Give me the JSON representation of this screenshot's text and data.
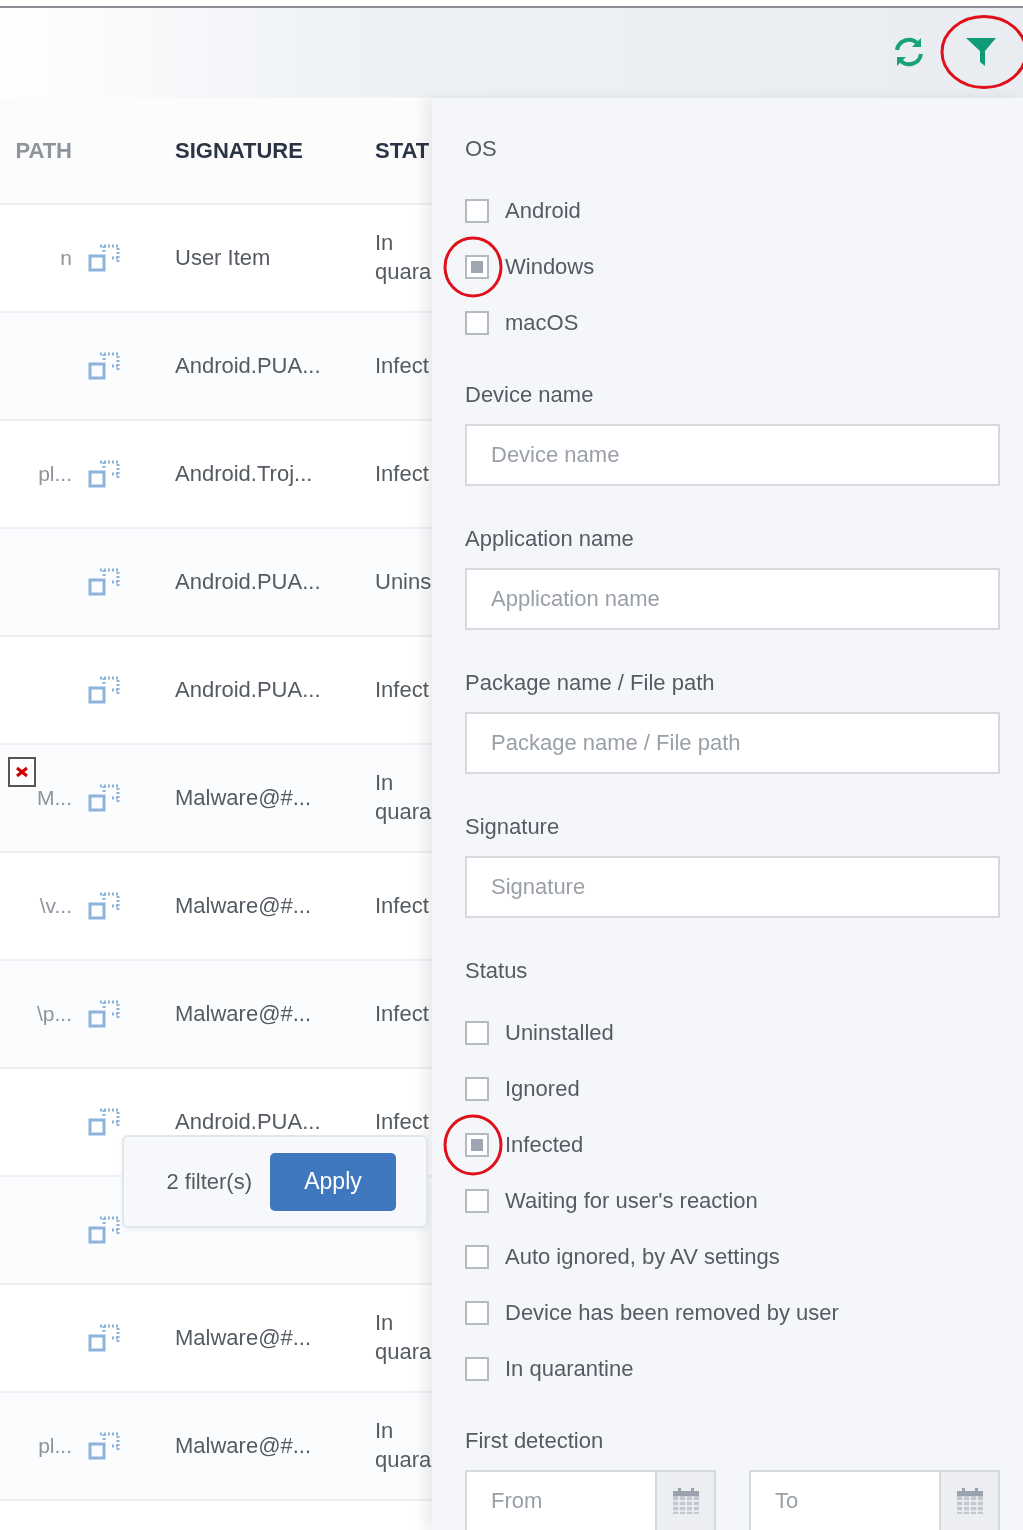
{
  "toolbar": {
    "filter_button": {
      "highlighted": true
    }
  },
  "table": {
    "columns": [
      "PATH",
      "SIGNATURE",
      "STAT"
    ],
    "rows": [
      {
        "path": "n",
        "signature": "User Item",
        "status": "In quara"
      },
      {
        "signature": "Android.PUA...",
        "status": "Infect"
      },
      {
        "path": "pl...",
        "signature": "Android.Troj...",
        "status": "Infect"
      },
      {
        "signature": "Android.PUA...",
        "status": "Unins"
      },
      {
        "signature": "Android.PUA...",
        "status": "Infect"
      },
      {
        "path": "M...",
        "signature": "Malware@#...",
        "status": "In quara"
      },
      {
        "path": "\\v...",
        "signature": "Malware@#...",
        "status": "Infect"
      },
      {
        "path": "\\p...",
        "signature": "Malware@#...",
        "status": "Infect"
      },
      {
        "signature": "Android.PUA...",
        "status": "Infect"
      },
      {},
      {
        "signature": "Malware@#...",
        "status": "In quara"
      },
      {
        "path": "pl...",
        "signature": "Malware@#...",
        "status": "In quara"
      }
    ]
  },
  "apply_popup": {
    "count": "2 filter(s)",
    "button": "Apply"
  },
  "filter_panel": {
    "os": {
      "label": "OS",
      "options": [
        {
          "label": "Android",
          "checked": false,
          "highlighted": false
        },
        {
          "label": "Windows",
          "checked": true,
          "highlighted": true
        },
        {
          "label": "macOS",
          "checked": false,
          "highlighted": false
        }
      ]
    },
    "fields": [
      {
        "label": "Device name",
        "placeholder": "Device name"
      },
      {
        "label": "Application name",
        "placeholder": "Application name"
      },
      {
        "label": "Package name / File path",
        "placeholder": "Package name / File path"
      },
      {
        "label": "Signature",
        "placeholder": "Signature"
      }
    ],
    "status": {
      "label": "Status",
      "options": [
        {
          "label": "Uninstalled",
          "checked": false,
          "highlighted": false
        },
        {
          "label": "Ignored",
          "checked": false,
          "highlighted": false
        },
        {
          "label": "Infected",
          "checked": true,
          "highlighted": true
        },
        {
          "label": "Waiting for user's reaction",
          "checked": false,
          "highlighted": false
        },
        {
          "label": "Auto ignored, by AV settings",
          "checked": false,
          "highlighted": false
        },
        {
          "label": "Device has been removed by user",
          "checked": false,
          "highlighted": false
        },
        {
          "label": "In quarantine",
          "checked": false,
          "highlighted": false
        }
      ]
    },
    "first_detection": {
      "label": "First detection",
      "from_placeholder": "From",
      "to_placeholder": "To"
    }
  }
}
